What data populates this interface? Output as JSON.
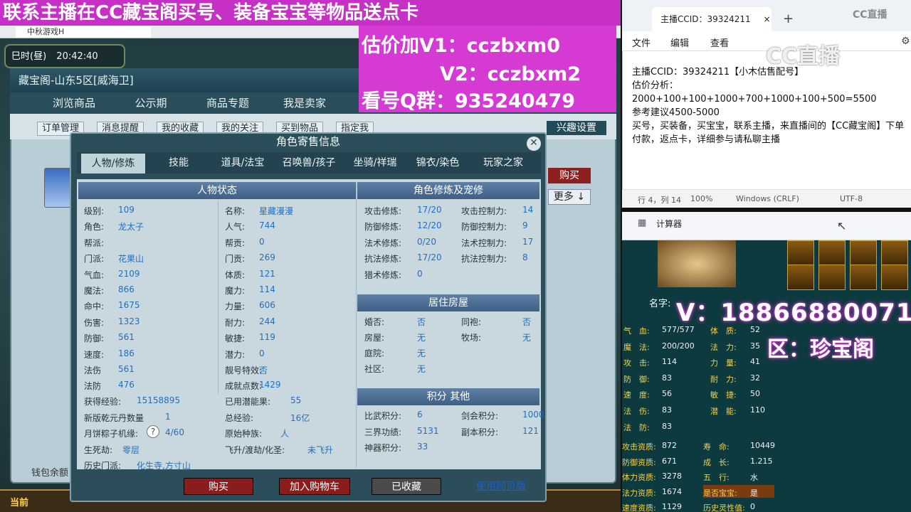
{
  "promo": {
    "banner": "联系主播在CC藏宝阁买号、装备宝宝等物品送点卡",
    "price_v1": "估价加V1：cczbxm0",
    "price_v2": "V2：cczbxm2",
    "qq_group": "看号Q群：935240479"
  },
  "game": {
    "tab_title": "中秋游戏H",
    "time_label": "巳时(昼)",
    "time_value": "20:42:40",
    "bottom_current": "当前"
  },
  "cbg": {
    "title": "藏宝阁-山东5区[威海卫]",
    "nav": [
      "浏览商品",
      "公示期",
      "商品专题",
      "我是卖家"
    ],
    "subnav": [
      "订单管理",
      "消息提醒",
      "我的收藏",
      "我的关注",
      "买到物品",
      "指定我"
    ],
    "fav_settings": "兴趣设置",
    "side_buy": "购买",
    "side_more": "更多 ↓",
    "wallet": "钱包余额"
  },
  "dialog": {
    "title": "角色寄售信息",
    "tabs": [
      "人物/修炼",
      "技能",
      "道具/法宝",
      "召唤兽/孩子",
      "坐骑/祥瑞",
      "锦衣/染色",
      "玩家之家"
    ],
    "status_header": "人物状态",
    "cultivation_header": "角色修炼及宠修",
    "house_header": "居住房屋",
    "points_header": "积分 其他",
    "left_col": [
      {
        "label": "级别:",
        "value": "109"
      },
      {
        "label": "角色:",
        "value": "龙太子"
      },
      {
        "label": "帮派:",
        "value": ""
      },
      {
        "label": "门派:",
        "value": "花果山"
      },
      {
        "label": "气血:",
        "value": "2109"
      },
      {
        "label": "魔法:",
        "value": "866"
      },
      {
        "label": "命中:",
        "value": "1675"
      },
      {
        "label": "伤害:",
        "value": "1323"
      },
      {
        "label": "防御:",
        "value": "561"
      },
      {
        "label": "速度:",
        "value": "186"
      },
      {
        "label": "法伤",
        "value": "561"
      },
      {
        "label": "法防",
        "value": "476"
      }
    ],
    "mid_col": [
      {
        "label": "名称:",
        "value": "星藏漫漫"
      },
      {
        "label": "人气:",
        "value": "744"
      },
      {
        "label": "帮贡:",
        "value": "0"
      },
      {
        "label": "门贡:",
        "value": "269"
      },
      {
        "label": "体质:",
        "value": "121"
      },
      {
        "label": "魔力:",
        "value": "114"
      },
      {
        "label": "力量:",
        "value": "606"
      },
      {
        "label": "耐力:",
        "value": "244"
      },
      {
        "label": "敏捷:",
        "value": "119"
      },
      {
        "label": "潜力:",
        "value": "0"
      },
      {
        "label": "靓号特效:",
        "value": "否"
      },
      {
        "label": "成就点数:",
        "value": "1429"
      }
    ],
    "extra_rows": [
      {
        "l1": "获得经验:",
        "v1": "15158895",
        "l2": "已用潜能果:",
        "v2": "55"
      },
      {
        "l1": "新版乾元丹数量",
        "v1": "1",
        "l2": "总经验:",
        "v2": "16亿"
      },
      {
        "l1": "月饼粽子机缘:",
        "v1": "4/60",
        "l2": "原始种族:",
        "v2": "人"
      },
      {
        "l1": "生死劫:",
        "v1": "零层",
        "l2": "飞升/渡劫/化圣:",
        "v2": "未飞升"
      },
      {
        "l1": "历史门派:",
        "v1": "化生寺,方寸山",
        "l2": "",
        "v2": ""
      }
    ],
    "help_glyph": "?",
    "cultivation": [
      {
        "l1": "攻击修炼:",
        "v1": "17/20",
        "l2": "攻击控制力:",
        "v2": "14"
      },
      {
        "l1": "防御修炼:",
        "v1": "12/20",
        "l2": "防御控制力:",
        "v2": "9"
      },
      {
        "l1": "法术修炼:",
        "v1": "0/20",
        "l2": "法术控制力:",
        "v2": "17"
      },
      {
        "l1": "抗法修炼:",
        "v1": "17/20",
        "l2": "抗法控制力:",
        "v2": "8"
      },
      {
        "l1": "猎术修炼:",
        "v1": "0",
        "l2": "",
        "v2": ""
      }
    ],
    "house": [
      {
        "l1": "婚否:",
        "v1": "否",
        "l2": "同袍:",
        "v2": "否"
      },
      {
        "l1": "房屋:",
        "v1": "无",
        "l2": "牧场:",
        "v2": "无"
      },
      {
        "l1": "庭院:",
        "v1": "无",
        "l2": "",
        "v2": ""
      },
      {
        "l1": "社区:",
        "v1": "无",
        "l2": "",
        "v2": ""
      }
    ],
    "points": [
      {
        "l1": "比武积分:",
        "v1": "6",
        "l2": "剑会积分:",
        "v2": "1000"
      },
      {
        "l1": "三界功绩:",
        "v1": "5131",
        "l2": "副本积分:",
        "v2": "121"
      },
      {
        "l1": "神器积分:",
        "v1": "33",
        "l2": "",
        "v2": ""
      }
    ],
    "buttons": {
      "buy": "购买",
      "cart": "加入购物车",
      "favorited": "已收藏",
      "web": "使用网页版"
    }
  },
  "notepad": {
    "tab_title": "主播CCID：39324211",
    "menu": [
      "文件",
      "编辑",
      "查看"
    ],
    "lines": [
      "主播CCID：39324211【小木估售配号】",
      "估价分析：",
      "2000+100+100+1000+700+1000+100+500=5500",
      "参考建议4500-5000",
      "买号，买装备，买宝宝，联系主播，来直播间的【CC藏宝阁】下单付款，返点卡，详细参与请私聊主播"
    ],
    "status": {
      "pos": "行 4，列 14",
      "zoom": "100%",
      "eol": "Windows (CRLF)",
      "enc": "UTF-8"
    },
    "logo": "CC直播",
    "logo_small": "CC直播"
  },
  "calculator": {
    "title": "计算器"
  },
  "right_panel": {
    "v_contact": "V：18866880071",
    "zone": "区：珍宝阁",
    "name_label": "名字:",
    "stats_left": [
      {
        "label": "气　血:",
        "value": "577/577"
      },
      {
        "label": "魔　法:",
        "value": "200/200"
      },
      {
        "label": "攻　击:",
        "value": "114"
      },
      {
        "label": "防　御:",
        "value": "83"
      },
      {
        "label": "速　度:",
        "value": "56"
      },
      {
        "label": "法　伤:",
        "value": "83"
      },
      {
        "label": "法　防:",
        "value": "83"
      }
    ],
    "stats_right": [
      {
        "label": "体　质:",
        "value": "52"
      },
      {
        "label": "法　力:",
        "value": "35"
      },
      {
        "label": "力　量:",
        "value": "41"
      },
      {
        "label": "耐　力:",
        "value": "32"
      },
      {
        "label": "敏　捷:",
        "value": "50"
      },
      {
        "label": "潜　能:",
        "value": "110"
      }
    ],
    "aptitude_left": [
      {
        "label": "攻击资质:",
        "value": "872"
      },
      {
        "label": "防御资质:",
        "value": "671"
      },
      {
        "label": "体力资质:",
        "value": "3278"
      },
      {
        "label": "法力资质:",
        "value": "1674"
      },
      {
        "label": "速度资质:",
        "value": "1129"
      }
    ],
    "aptitude_right": [
      {
        "label": "寿　命:",
        "value": "10449"
      },
      {
        "label": "成　长:",
        "value": "1.215"
      },
      {
        "label": "五　行:",
        "value": "水"
      },
      {
        "label": "是否宝宝:",
        "value": "是"
      },
      {
        "label": "历史灵性值:",
        "value": "0"
      }
    ]
  }
}
